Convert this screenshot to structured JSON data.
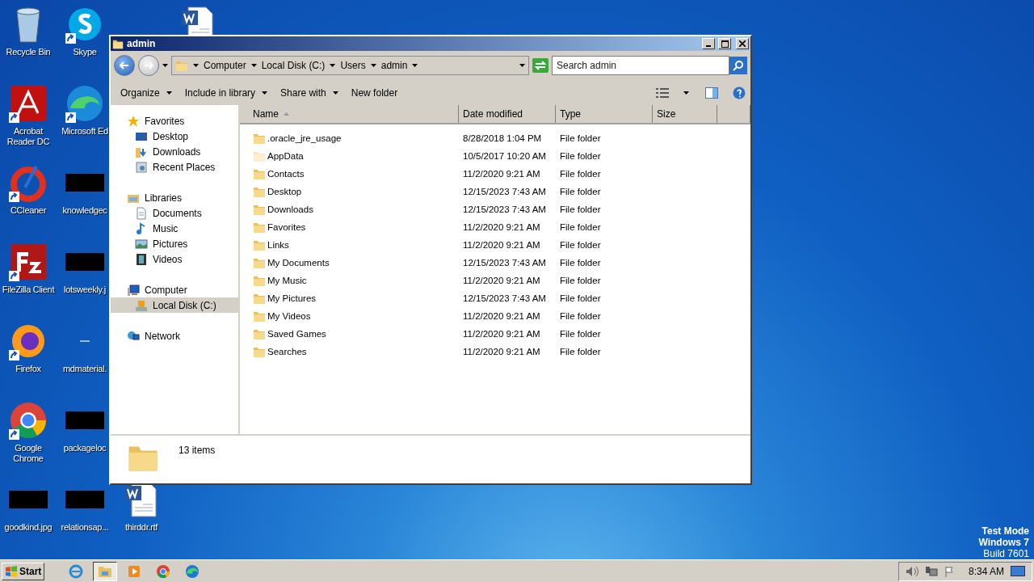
{
  "desktop": {
    "icons": [
      {
        "label": "Recycle Bin",
        "kind": "trash"
      },
      {
        "label": "Acrobat\nReader DC",
        "kind": "pdf",
        "shortcut": true
      },
      {
        "label": "CCleaner",
        "kind": "broom",
        "shortcut": true
      },
      {
        "label": "FileZilla Client",
        "kind": "ftp",
        "shortcut": true
      },
      {
        "label": "Firefox",
        "kind": "fox",
        "shortcut": true
      },
      {
        "label": "Google\nChrome",
        "kind": "chrome",
        "shortcut": true
      },
      {
        "label": "goodkind.jpg",
        "kind": "thumb"
      },
      {
        "label": "Skype",
        "kind": "chat",
        "shortcut": true
      },
      {
        "label": "Microsoft Ed",
        "kind": "wave",
        "shortcut": true
      },
      {
        "label": "knowledgec",
        "kind": "thumb"
      },
      {
        "label": "lotsweekly.j",
        "kind": "thumb"
      },
      {
        "label": "mdmaterial.",
        "kind": "blank"
      },
      {
        "label": "packageloc",
        "kind": "thumb"
      },
      {
        "label": "relationsap...",
        "kind": "thumb"
      },
      {
        "label": "thirddr.rtf",
        "kind": "doc"
      },
      {
        "kind": "doc"
      }
    ],
    "os_notice": [
      "Test Mode",
      "Windows 7",
      "Build 7601"
    ]
  },
  "window": {
    "title": "admin",
    "breadcrumb": [
      "Computer",
      "Local Disk (C:)",
      "Users",
      "admin"
    ],
    "search": {
      "placeholder": "Search admin"
    },
    "toolbar": [
      {
        "label": "Organize",
        "dropdown": true
      },
      {
        "label": "Include in library",
        "dropdown": true
      },
      {
        "label": "Share with",
        "dropdown": true
      },
      {
        "label": "New folder",
        "dropdown": false
      }
    ],
    "nav": [
      {
        "label": "Favorites",
        "kind": "star",
        "selected": false,
        "children": [
          {
            "label": "Desktop",
            "kind": "screen",
            "selected": false
          },
          {
            "label": "Downloads",
            "kind": "download",
            "selected": false
          },
          {
            "label": "Recent Places",
            "kind": "recent",
            "selected": false
          }
        ]
      },
      {
        "label": "Libraries",
        "kind": "library",
        "selected": false,
        "children": [
          {
            "label": "Documents",
            "kind": "document",
            "selected": false
          },
          {
            "label": "Music",
            "kind": "note",
            "selected": false
          },
          {
            "label": "Pictures",
            "kind": "image",
            "selected": false
          },
          {
            "label": "Videos",
            "kind": "film",
            "selected": false
          }
        ]
      },
      {
        "label": "Computer",
        "kind": "computer",
        "selected": false,
        "children": [
          {
            "label": "Local Disk (C:)",
            "kind": "disk",
            "selected": true
          }
        ]
      },
      {
        "label": "Network",
        "kind": "globe",
        "selected": false
      }
    ],
    "columns": [
      "Name",
      "Date modified",
      "Type",
      "Size"
    ],
    "rows": [
      {
        "name": ".oracle_jre_usage",
        "date": "8/28/2018 1:04 PM",
        "type": "File folder",
        "hidden": false
      },
      {
        "name": "AppData",
        "date": "10/5/2017 10:20 AM",
        "type": "File folder",
        "hidden": true
      },
      {
        "name": "Contacts",
        "date": "11/2/2020 9:21 AM",
        "type": "File folder",
        "hidden": false
      },
      {
        "name": "Desktop",
        "date": "12/15/2023 7:43 AM",
        "type": "File folder",
        "hidden": false
      },
      {
        "name": "Downloads",
        "date": "12/15/2023 7:43 AM",
        "type": "File folder",
        "hidden": false
      },
      {
        "name": "Favorites",
        "date": "11/2/2020 9:21 AM",
        "type": "File folder",
        "hidden": false
      },
      {
        "name": "Links",
        "date": "11/2/2020 9:21 AM",
        "type": "File folder",
        "hidden": false
      },
      {
        "name": "My Documents",
        "date": "12/15/2023 7:43 AM",
        "type": "File folder",
        "hidden": false
      },
      {
        "name": "My Music",
        "date": "11/2/2020 9:21 AM",
        "type": "File folder",
        "hidden": false
      },
      {
        "name": "My Pictures",
        "date": "12/15/2023 7:43 AM",
        "type": "File folder",
        "hidden": false
      },
      {
        "name": "My Videos",
        "date": "11/2/2020 9:21 AM",
        "type": "File folder",
        "hidden": false
      },
      {
        "name": "Saved Games",
        "date": "11/2/2020 9:21 AM",
        "type": "File folder",
        "hidden": false
      },
      {
        "name": "Searches",
        "date": "11/2/2020 9:21 AM",
        "type": "File folder",
        "hidden": false
      }
    ],
    "status": "13 items"
  },
  "taskbar": {
    "start": "Start",
    "apps": [
      {
        "kind": "ie",
        "active": false
      },
      {
        "kind": "explorer",
        "active": true
      },
      {
        "kind": "media",
        "active": false
      },
      {
        "kind": "chrome",
        "active": false
      },
      {
        "kind": "edge",
        "active": false
      }
    ],
    "clock": "8:34 AM"
  }
}
